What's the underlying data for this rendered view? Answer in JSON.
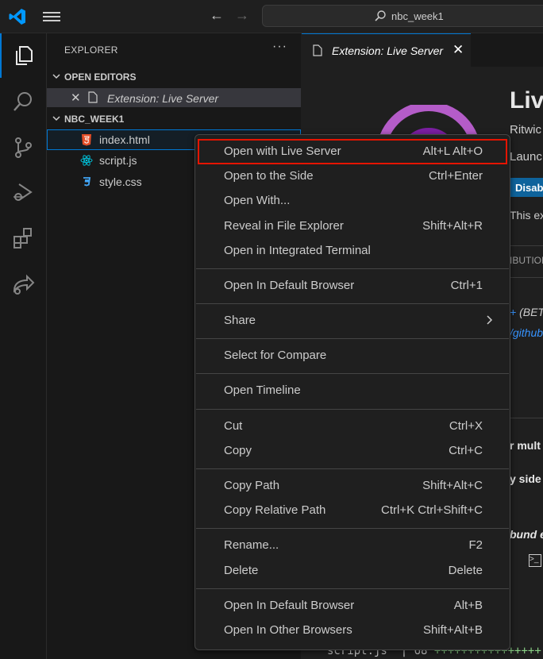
{
  "titlebar": {
    "search_text": "nbc_week1"
  },
  "activity_bar": {
    "items": [
      "explorer-icon",
      "search-icon",
      "source-control-icon",
      "run-debug-icon",
      "extensions-icon",
      "remote-share-icon"
    ]
  },
  "sidebar": {
    "title": "EXPLORER",
    "more": "···",
    "open_editors": {
      "header": "OPEN EDITORS",
      "items": [
        {
          "label": "Extension: Live Server"
        }
      ]
    },
    "folder": {
      "header": "NBC_WEEK1",
      "files": [
        {
          "label": "index.html",
          "icon": "html5-icon",
          "color": "#e44d26"
        },
        {
          "label": "script.js",
          "icon": "react-icon",
          "color": "#00bcd4"
        },
        {
          "label": "style.css",
          "icon": "css3-icon",
          "color": "#42a5f5"
        }
      ]
    }
  },
  "editor": {
    "tab": {
      "label": "Extension: Live Server",
      "close": "✕"
    },
    "extension": {
      "name": "Live",
      "author": "Ritwic",
      "desc": "Launc",
      "button": "Disabl",
      "text": "This ex",
      "nav": "IBUTION",
      "beta_plus": "+",
      "beta_text": " (BETA",
      "github": "/github",
      "heading1": "r mult",
      "heading2": "y side p",
      "heading3": "bund e"
    },
    "diff": {
      "file": "script.js",
      "sep": "|",
      "count": "68",
      "plus": "++++++++++++++++"
    }
  },
  "context_menu": {
    "items": [
      {
        "label": "Open with Live Server",
        "key": "Alt+L Alt+O",
        "highlight": true
      },
      {
        "label": "Open to the Side",
        "key": "Ctrl+Enter"
      },
      {
        "label": "Open With...",
        "key": ""
      },
      {
        "label": "Reveal in File Explorer",
        "key": "Shift+Alt+R"
      },
      {
        "label": "Open in Integrated Terminal",
        "key": ""
      },
      {
        "label": "Open In Default Browser",
        "key": "Ctrl+1"
      },
      {
        "label": "Share",
        "key": "",
        "submenu": true
      },
      {
        "label": "Select for Compare",
        "key": ""
      },
      {
        "label": "Open Timeline",
        "key": ""
      },
      {
        "label": "Cut",
        "key": "Ctrl+X"
      },
      {
        "label": "Copy",
        "key": "Ctrl+C"
      },
      {
        "label": "Copy Path",
        "key": "Shift+Alt+C"
      },
      {
        "label": "Copy Relative Path",
        "key": "Ctrl+K Ctrl+Shift+C"
      },
      {
        "label": "Rename...",
        "key": "F2"
      },
      {
        "label": "Delete",
        "key": "Delete"
      },
      {
        "label": "Open In Default Browser",
        "key": "Alt+B"
      },
      {
        "label": "Open In Other Browsers",
        "key": "Shift+Alt+B"
      }
    ]
  },
  "colors": {
    "accent": "#0078d4",
    "highlight_border": "#e51400",
    "menu_bg": "#1f1f1f"
  }
}
